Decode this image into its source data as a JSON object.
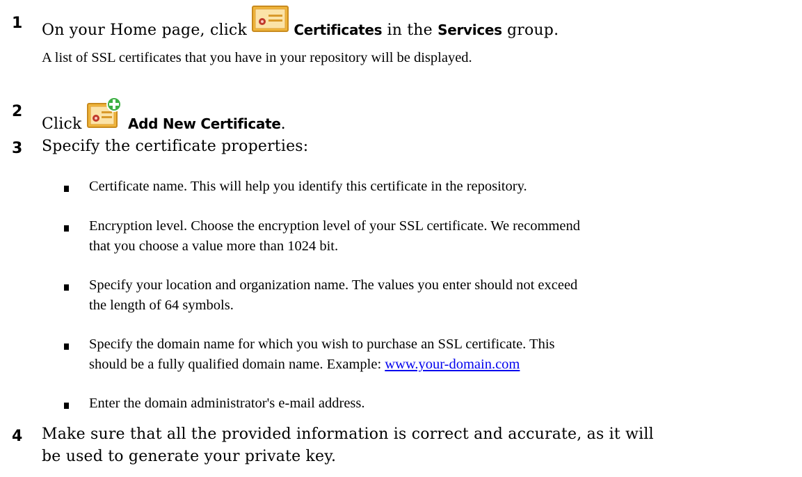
{
  "steps": [
    {
      "number": "1",
      "before": "On your Home page, click",
      "ui_label": "Certificates",
      "middle": "in the",
      "group_label": "Services",
      "after": "group.",
      "icon": "certificate-icon"
    },
    {
      "number": "2",
      "before": "Click",
      "ui_label": "Add New Certificate",
      "after": ".",
      "icon": "add-certificate-icon"
    },
    {
      "number": "3",
      "text": "Specify the certificate properties:"
    },
    {
      "number": "4",
      "line1": "Make sure that all the provided information is correct and accurate, as it will",
      "line2": "be used to generate your private key."
    }
  ],
  "step1_note": "A list of SSL certificates that you have in your repository will be displayed.",
  "bullets": [
    {
      "lines": [
        "Certificate name. This will help you identify this certificate in the repository."
      ]
    },
    {
      "lines": [
        "Encryption level. Choose the encryption level of your SSL certificate. We recommend",
        "that you choose a value more than 1024 bit."
      ]
    },
    {
      "lines": [
        "Specify your location and organization name. The values you enter should not exceed",
        "the length of 64 symbols."
      ]
    },
    {
      "lines": [
        "Specify the domain name for which you wish to purchase an SSL certificate. This",
        "should be a fully qualified domain name. Example: "
      ],
      "link": "www.your-domain.com"
    },
    {
      "lines": [
        "Enter the domain administrator's e-mail address."
      ]
    }
  ],
  "colors": {
    "certificate_gold": "#f0b63c",
    "certificate_border": "#c88a1e",
    "seal_red": "#c0392b",
    "plus_green": "#3cb043",
    "link_blue": "#0000ee"
  }
}
